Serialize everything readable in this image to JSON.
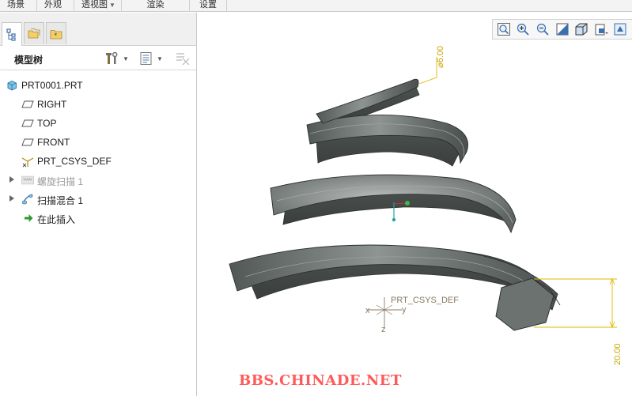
{
  "menu": {
    "tabs": [
      {
        "label": "场景"
      },
      {
        "label": "外观"
      },
      {
        "label": "透视图"
      },
      {
        "label": "渲染"
      },
      {
        "label": "设置"
      }
    ]
  },
  "panel": {
    "title": "模型树"
  },
  "tree": {
    "items": [
      {
        "label": "PRT0001.PRT"
      },
      {
        "label": "RIGHT"
      },
      {
        "label": "TOP"
      },
      {
        "label": "FRONT"
      },
      {
        "label": "PRT_CSYS_DEF"
      },
      {
        "label": "螺旋扫描 1"
      },
      {
        "label": "扫描混合 1"
      },
      {
        "label": "在此插入"
      }
    ]
  },
  "viewport": {
    "dimensions": {
      "diameter": "⌀6.00",
      "height": "20.00"
    },
    "csys_label": "PRT_CSYS_DEF",
    "axis_labels": {
      "x": "x",
      "y": "y",
      "z": "z"
    },
    "watermark": "BBS.CHINADE.NET"
  },
  "colors": {
    "model": "#5f6563",
    "dimension": "#e0b800",
    "watermark": "#ff5a5a",
    "toolbar_icon": "#3a6fb0"
  }
}
